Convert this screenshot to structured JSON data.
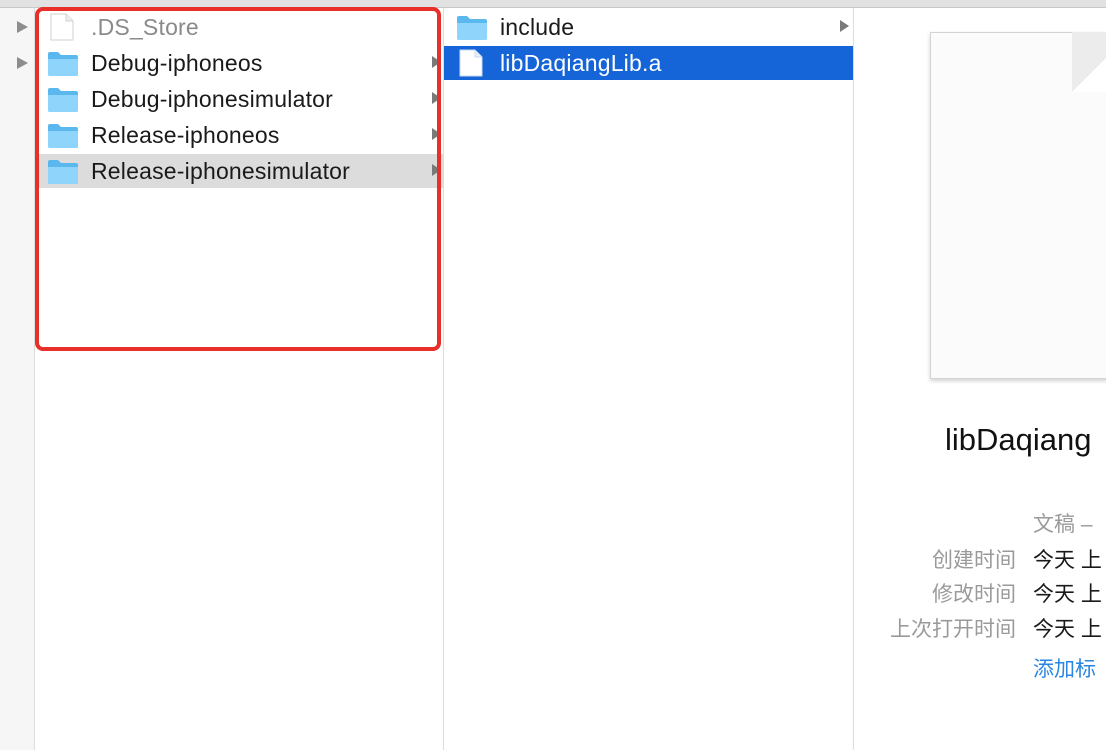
{
  "column0": {
    "expanders": [
      "",
      ""
    ]
  },
  "column1": {
    "items": [
      {
        "label": ".DS_Store",
        "type": "document",
        "dimmed": true,
        "has_children": false
      },
      {
        "label": "Debug-iphoneos",
        "type": "folder",
        "has_children": true
      },
      {
        "label": "Debug-iphonesimulator",
        "type": "folder",
        "has_children": true
      },
      {
        "label": "Release-iphoneos",
        "type": "folder",
        "has_children": true
      },
      {
        "label": "Release-iphonesimulator",
        "type": "folder",
        "has_children": true,
        "highlighted": true
      }
    ]
  },
  "column2": {
    "items": [
      {
        "label": "include",
        "type": "folder",
        "has_children": true
      },
      {
        "label": "libDaqiangLib.a",
        "type": "document",
        "selected": true
      }
    ]
  },
  "preview": {
    "filename": "libDaqiang",
    "kind": "文稿 –",
    "created_label": "创建时间",
    "created_value": "今天 上",
    "modified_label": "修改时间",
    "modified_value": "今天 上",
    "opened_label": "上次打开时间",
    "opened_value": "今天 上",
    "add_tags": "添加标"
  },
  "colors": {
    "selection": "#1665d8",
    "highlight_row": "#dcdcdc",
    "annotation_box": "#e8302a",
    "folder": "#6cc4f5",
    "link": "#2a86e0"
  }
}
